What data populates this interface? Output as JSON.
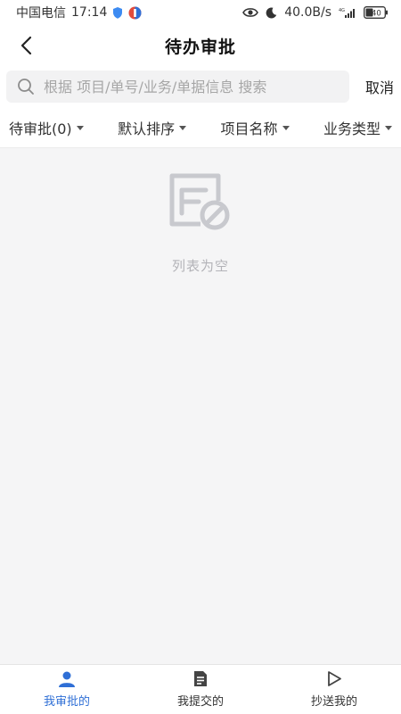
{
  "status_bar": {
    "carrier": "中国电信",
    "time": "17:14",
    "network_speed": "40.0B/s",
    "signal_tag": "4G",
    "battery": "40"
  },
  "nav": {
    "title": "待办审批",
    "back_icon": "chevron-left-icon"
  },
  "search": {
    "placeholder": "根据 项目/单号/业务/单据信息 搜索",
    "value": "",
    "cancel_label": "取消"
  },
  "filters": [
    {
      "label": "待审批(0)"
    },
    {
      "label": "默认排序"
    },
    {
      "label": "项目名称"
    },
    {
      "label": "业务类型"
    }
  ],
  "empty_state": {
    "icon": "empty-document-icon",
    "text": "列表为空"
  },
  "tabs": [
    {
      "label": "我审批的",
      "icon": "person-icon",
      "active": true
    },
    {
      "label": "我提交的",
      "icon": "document-icon",
      "active": false
    },
    {
      "label": "抄送我的",
      "icon": "play-icon",
      "active": false
    }
  ],
  "colors": {
    "accent": "#2f6fd6",
    "background": "#f5f5f6",
    "empty_icon": "#c8c9ce"
  }
}
